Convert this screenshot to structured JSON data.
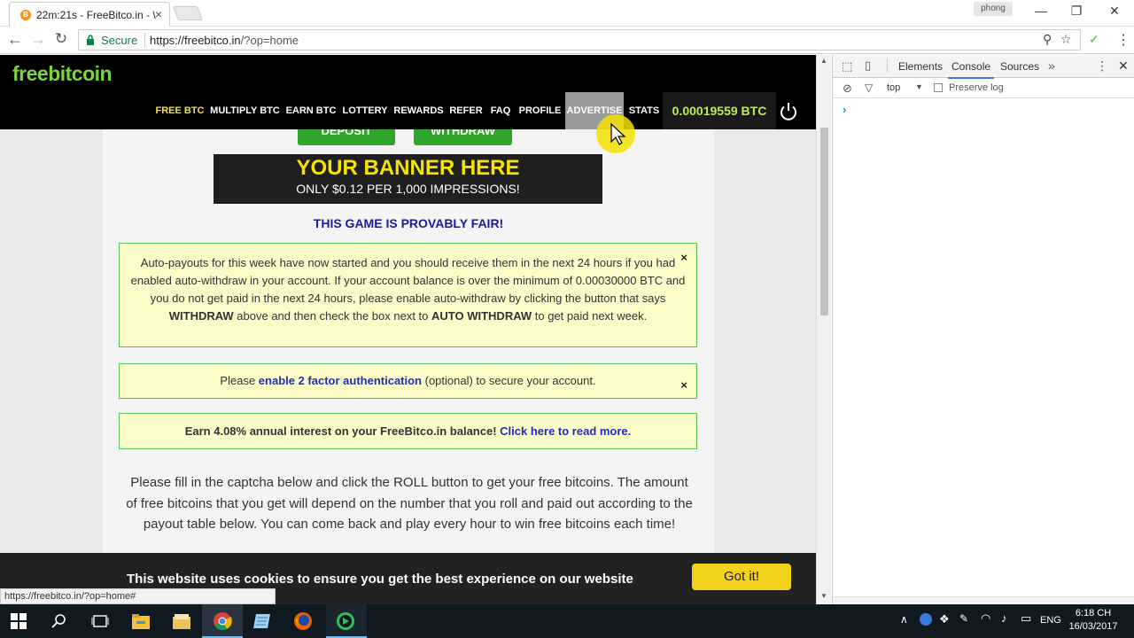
{
  "browser": {
    "tab_title": "22m:21s - FreeBitco.in - \\",
    "tab_favicon": "B",
    "profile_name": "phong",
    "secure_label": "Secure",
    "url_host": "https://freebitco.in",
    "url_path": "/?op=home",
    "status_url": "https://freebitco.in/?op=home#"
  },
  "site": {
    "logo": "freebitcoin",
    "nav": [
      {
        "label": "FREE BTC"
      },
      {
        "label": "MULTIPLY BTC"
      },
      {
        "label": "EARN BTC"
      },
      {
        "label": "LOTTERY"
      },
      {
        "label": "REWARDS"
      },
      {
        "label": "REFER"
      },
      {
        "label": "FAQ"
      },
      {
        "label": "PROFILE"
      },
      {
        "label": "ADVERTISE"
      },
      {
        "label": "STATS"
      }
    ],
    "balance": "0.00019559 BTC",
    "buttons": {
      "deposit": "DEPOSIT",
      "withdraw": "WITHDRAW"
    },
    "banner": {
      "title": "YOUR BANNER HERE",
      "subtitle": "ONLY $0.12 PER 1,000 IMPRESSIONS!"
    },
    "fair_label": "THIS GAME IS PROVABLY FAIR!",
    "notice1": {
      "part1": "Auto-payouts for this week have now started and you should receive them in the next 24 hours if you had enabled auto-withdraw in your account. If your account balance is over the minimum of 0.00030000 BTC and you do not get paid in the next 24 hours, please enable auto-withdraw by clicking the button that says ",
      "bold1": "WITHDRAW",
      "part2": " above and then check the box next to ",
      "bold2": "AUTO WITHDRAW",
      "part3": " to get paid next week.",
      "close": "×"
    },
    "notice2": {
      "prefix": "Please ",
      "link": "enable 2 factor authentication",
      "suffix": " (optional) to secure your account.",
      "close": "×"
    },
    "notice3": {
      "text": "Earn 4.08% annual interest on your FreeBitco.in balance! ",
      "link": "Click here to read more."
    },
    "description": "Please fill in the captcha below and click the ROLL button to get your free bitcoins. The amount of free bitcoins that you get will depend on the number that you roll and paid out according to the payout table below. You can come back and play every hour to win free bitcoins each time!",
    "cookie": {
      "message": "This website uses cookies to ensure you get the best experience on our website",
      "button": "Got it!"
    }
  },
  "devtools": {
    "tabs": [
      "Elements",
      "Console",
      "Sources"
    ],
    "context": "top",
    "preserve_log": "Preserve log",
    "prompt": "›"
  },
  "taskbar": {
    "language": "ENG",
    "time": "6:18 CH",
    "date": "16/03/2017"
  },
  "colors": {
    "logo": "#7cd43e",
    "balance": "#b8f04a",
    "accent_link": "#1f2fb8",
    "got_it": "#f2d21b"
  }
}
